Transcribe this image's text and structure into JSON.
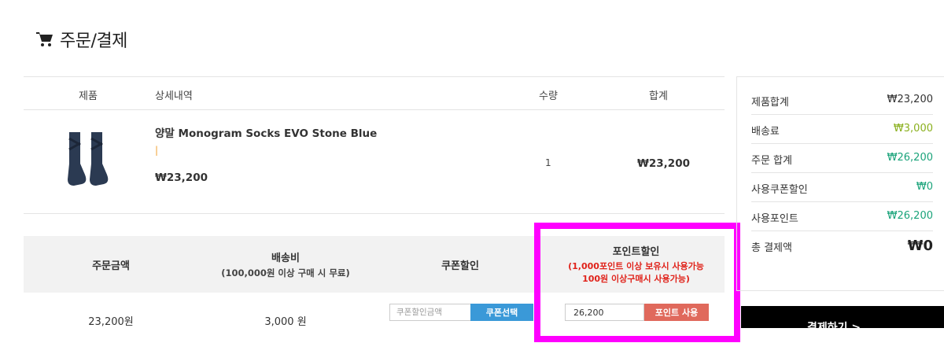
{
  "page": {
    "title": "주문/결제",
    "icon": "cart-icon"
  },
  "product_table": {
    "headers": {
      "product": "제품",
      "detail": "상세내역",
      "qty": "수량",
      "sum": "합계"
    },
    "rows": [
      {
        "image": "socks-image",
        "name": "양말 Monogram Socks EVO Stone Blue",
        "option": "|",
        "price": "₩23,200",
        "qty": "1",
        "total": "₩23,200"
      }
    ]
  },
  "discount_table": {
    "headers": {
      "order_amount": "주문금액",
      "shipping": "배송비",
      "shipping_note": "(100,000원 이상 구매 시 무료)",
      "coupon": "쿠폰할인",
      "points": "포인트할인",
      "points_note_1": "(1,000포인트 이상 보유시 사용가능",
      "points_note_2": "100원 이상구매시 사용가능)"
    },
    "values": {
      "order_amount": "23,200원",
      "shipping": "3,000 원"
    },
    "coupon": {
      "placeholder": "쿠폰할인금액",
      "button": "쿠폰선택"
    },
    "points": {
      "value": "26,200",
      "button": "포인트 사용"
    }
  },
  "summary": {
    "rows": [
      {
        "label": "제품합계",
        "value": "₩23,200",
        "color": "#333333"
      },
      {
        "label": "배송료",
        "value": "₩3,000",
        "color": "#8ab01e"
      },
      {
        "label": "주문 합계",
        "value": "₩26,200",
        "color": "#1aa37a"
      },
      {
        "label": "사용쿠폰할인",
        "value": "₩0",
        "color": "#1aa37a"
      },
      {
        "label": "사용포인트",
        "value": "₩26,200",
        "color": "#1aa37a"
      }
    ],
    "total_label": "총 결제액",
    "total_value": "₩0",
    "pay_button": "결제하기 >"
  },
  "highlight_color": "#ff00ff"
}
